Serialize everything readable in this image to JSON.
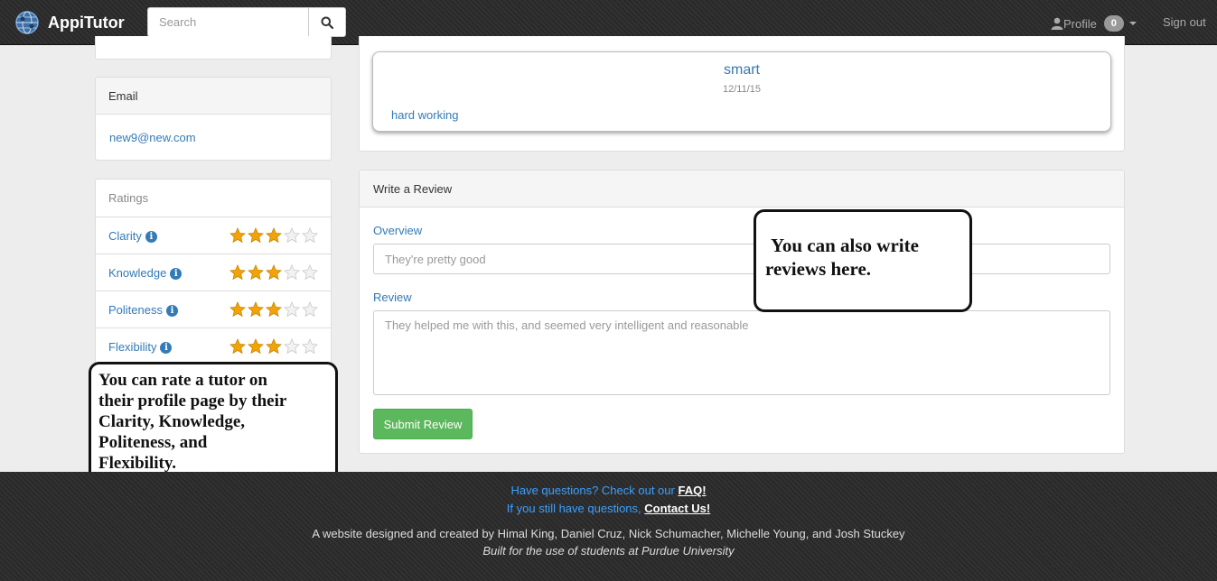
{
  "navbar": {
    "brand": "AppiTutor",
    "search_placeholder": "Search",
    "profile_label": "Profile",
    "notification_count": "0",
    "signout_label": "Sign out"
  },
  "sidebar": {
    "email_heading": "Email",
    "email_value": "new9@new.com",
    "ratings_heading": "Ratings",
    "ratings": [
      {
        "label": "Clarity",
        "stars": 3,
        "max": 5
      },
      {
        "label": "Knowledge",
        "stars": 3,
        "max": 5
      },
      {
        "label": "Politeness",
        "stars": 3,
        "max": 5
      },
      {
        "label": "Flexibility",
        "stars": 3,
        "max": 5
      }
    ]
  },
  "existing_review": {
    "title": "smart",
    "date": "12/11/15",
    "body": "hard working"
  },
  "write_review": {
    "heading": "Write a Review",
    "overview_label": "Overview",
    "overview_placeholder": "They're pretty good",
    "review_label": "Review",
    "review_placeholder": "They helped me with this, and seemed very intelligent and reasonable",
    "submit_label": "Submit Review"
  },
  "callouts": {
    "reviews_line1": "You can also write",
    "reviews_line2": "reviews here.",
    "ratings_lines": [
      "You can rate a tutor on",
      "their profile page by their",
      "Clarity, Knowledge,",
      "Politeness, and",
      "Flexibility."
    ]
  },
  "footer": {
    "faq_prefix": "Have questions? Check out our",
    "faq_link": "FAQ!",
    "contact_prefix": "If you still have questions,",
    "contact_link": "Contact Us!",
    "credits": "A website designed and created by Himal King, Daniel Cruz, Nick Schumacher, Michelle Young, and Josh Stuckey",
    "built_for": "Built for the use of students at Purdue University"
  },
  "colors": {
    "link": "#337ab7",
    "star_filled": "#f0a30a",
    "star_empty": "#dddddd",
    "submit": "#5cb85c",
    "nav_bg": "#2b2b2b"
  }
}
